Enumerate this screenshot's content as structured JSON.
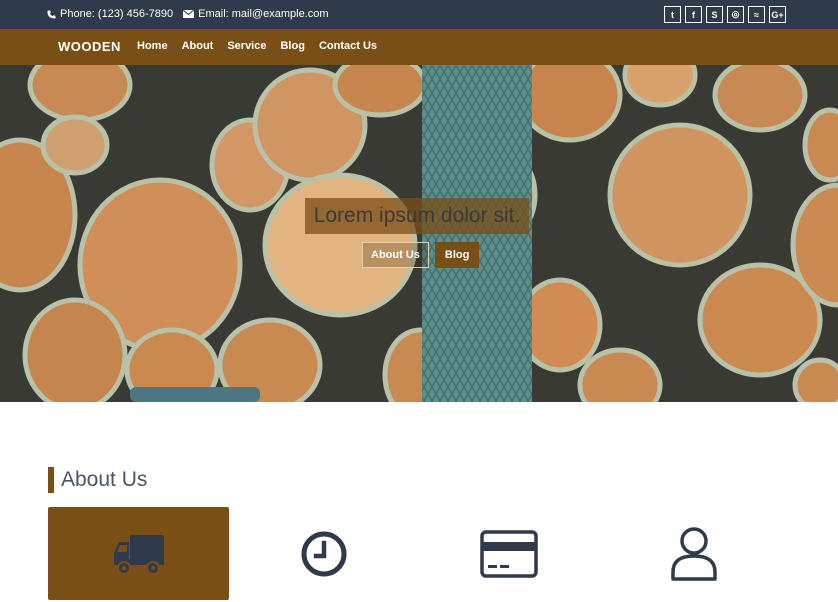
{
  "topbar": {
    "phone": "Phone: (123) 456-7890",
    "email": "Email: mail@example.com",
    "social": [
      {
        "name": "twitter-icon",
        "glyph": "t"
      },
      {
        "name": "facebook-icon",
        "glyph": "f"
      },
      {
        "name": "skype-icon",
        "glyph": "S"
      },
      {
        "name": "dribbble-icon",
        "glyph": "◎"
      },
      {
        "name": "rss-icon",
        "glyph": "≈"
      },
      {
        "name": "google-plus-icon",
        "glyph": "G+"
      }
    ]
  },
  "nav": {
    "brand": "WOODEN",
    "links": [
      "Home",
      "About",
      "Service",
      "Blog",
      "Contact Us"
    ]
  },
  "hero": {
    "title": "Lorem ipsum dolor sit.",
    "button_about": "About Us",
    "button_blog": "Blog"
  },
  "about": {
    "heading": "About Us",
    "features": [
      {
        "icon": "truck-icon",
        "active": true
      },
      {
        "icon": "clock-icon",
        "active": false
      },
      {
        "icon": "credit-card-icon",
        "active": false
      },
      {
        "icon": "user-icon",
        "active": false
      }
    ]
  },
  "colors": {
    "topbar": "#2f3a4a",
    "brand": "#7a4f16",
    "icon": "#2f3a4a"
  }
}
